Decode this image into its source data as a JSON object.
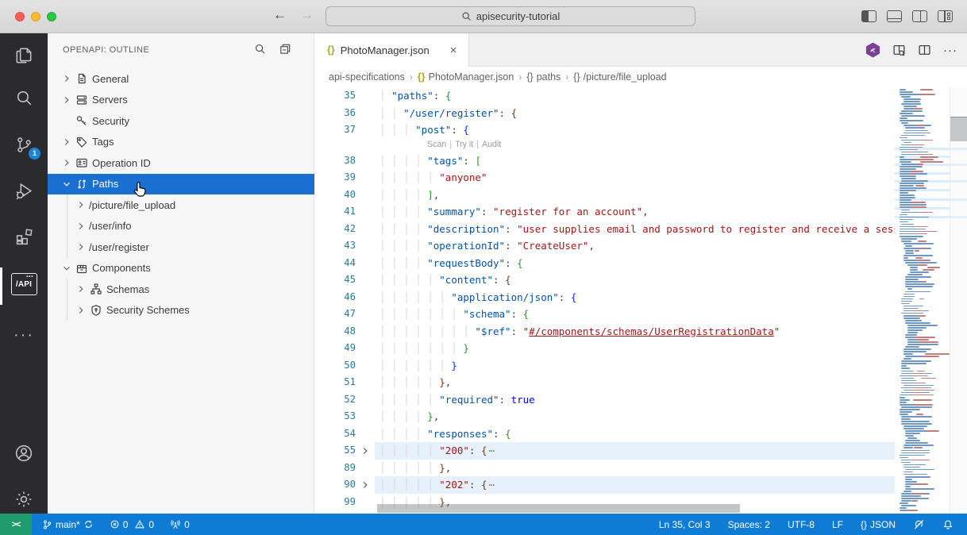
{
  "titlebar": {
    "traffic_lights": [
      "close",
      "minimize",
      "zoom"
    ],
    "back_glyph": "←",
    "forward_glyph": "→",
    "command_center": {
      "value": "apisecurity-tutorial",
      "icon": "search-icon"
    },
    "layout_controls": [
      "toggle-primary-sidebar-icon",
      "toggle-panel-icon",
      "toggle-secondary-sidebar-icon",
      "customize-layout-icon"
    ]
  },
  "activity_bar": {
    "items": [
      {
        "name": "explorer",
        "icon": "files-icon"
      },
      {
        "name": "search",
        "icon": "search-icon"
      },
      {
        "name": "source-control",
        "icon": "source-control-icon",
        "badge": "1"
      },
      {
        "name": "run-debug",
        "icon": "debug-icon"
      },
      {
        "name": "extensions",
        "icon": "extensions-icon"
      },
      {
        "name": "openapi",
        "icon": "api-icon",
        "label": "/API",
        "active": true
      },
      {
        "name": "more",
        "icon": "ellipsis-icon"
      }
    ],
    "bottom": [
      {
        "name": "accounts",
        "icon": "account-icon"
      },
      {
        "name": "settings",
        "icon": "gear-icon"
      }
    ]
  },
  "sidebar": {
    "title": "OPENAPI: OUTLINE",
    "actions": [
      "search-icon",
      "collapse-all-icon"
    ],
    "tree": [
      {
        "label": "General",
        "icon": "file-icon",
        "chevron": "right",
        "depth": 0
      },
      {
        "label": "Servers",
        "icon": "server-icon",
        "chevron": "right",
        "depth": 0
      },
      {
        "label": "Security",
        "icon": "key-icon",
        "chevron": "none",
        "depth": 0
      },
      {
        "label": "Tags",
        "icon": "tag-icon",
        "chevron": "right",
        "depth": 0
      },
      {
        "label": "Operation ID",
        "icon": "id-card-icon",
        "chevron": "right",
        "depth": 0
      },
      {
        "label": "Paths",
        "icon": "paths-icon",
        "chevron": "down",
        "depth": 0,
        "selected": true
      },
      {
        "label": "/picture/file_upload",
        "icon": null,
        "chevron": "right",
        "depth": 1
      },
      {
        "label": "/user/info",
        "icon": null,
        "chevron": "right",
        "depth": 1
      },
      {
        "label": "/user/register",
        "icon": null,
        "chevron": "right",
        "depth": 1
      },
      {
        "label": "Components",
        "icon": "package-icon",
        "chevron": "down",
        "depth": 0
      },
      {
        "label": "Schemas",
        "icon": "schema-icon",
        "chevron": "right",
        "depth": 1
      },
      {
        "label": "Security Schemes",
        "icon": "shield-icon",
        "chevron": "right",
        "depth": 1
      }
    ]
  },
  "editor": {
    "tab": {
      "label": "PhotoManager.json",
      "icon": "json-braces-icon",
      "close": "×"
    },
    "actions": [
      "42crunch-icon",
      "open-preview-icon",
      "split-editor-icon",
      "ellipsis-icon"
    ],
    "breadcrumbs": [
      {
        "label": "api-specifications",
        "icon": null
      },
      {
        "label": "PhotoManager.json",
        "icon": "braces-yellow"
      },
      {
        "label": "paths",
        "icon": "braces-gray"
      },
      {
        "label": "/picture/file_upload",
        "icon": "braces-gray"
      }
    ],
    "codelens_labels": [
      "Scan",
      "Try it",
      "Audit"
    ],
    "fold_marker": "⋯",
    "lines": [
      {
        "n": "35",
        "i": 2,
        "t": [
          [
            "k",
            "\"paths\""
          ],
          [
            "p",
            ": "
          ],
          [
            "b2",
            "{"
          ]
        ]
      },
      {
        "n": "36",
        "i": 4,
        "t": [
          [
            "k",
            "\"/user/register\""
          ],
          [
            "p",
            ": "
          ],
          [
            "b3",
            "{"
          ]
        ]
      },
      {
        "n": "37",
        "i": 6,
        "t": [
          [
            "k",
            "\"post\""
          ],
          [
            "p",
            ": "
          ],
          [
            "b1",
            "{"
          ]
        ]
      },
      {
        "lens": true,
        "i": 8
      },
      {
        "n": "38",
        "i": 8,
        "t": [
          [
            "k",
            "\"tags\""
          ],
          [
            "p",
            ": "
          ],
          [
            "b2",
            "["
          ]
        ]
      },
      {
        "n": "39",
        "i": 10,
        "t": [
          [
            "s",
            "\"anyone\""
          ]
        ]
      },
      {
        "n": "40",
        "i": 8,
        "t": [
          [
            "b2",
            "]"
          ],
          [
            "p",
            ","
          ]
        ]
      },
      {
        "n": "41",
        "i": 8,
        "t": [
          [
            "k",
            "\"summary\""
          ],
          [
            "p",
            ": "
          ],
          [
            "s",
            "\"register for an account\""
          ],
          [
            "p",
            ","
          ]
        ]
      },
      {
        "n": "42",
        "i": 8,
        "t": [
          [
            "k",
            "\"description\""
          ],
          [
            "p",
            ": "
          ],
          [
            "s",
            "\"user supplies email and password to register and receive a session token\""
          ],
          [
            "p",
            ","
          ]
        ]
      },
      {
        "n": "43",
        "i": 8,
        "t": [
          [
            "k",
            "\"operationId\""
          ],
          [
            "p",
            ": "
          ],
          [
            "s",
            "\"CreateUser\""
          ],
          [
            "p",
            ","
          ]
        ]
      },
      {
        "n": "44",
        "i": 8,
        "t": [
          [
            "k",
            "\"requestBody\""
          ],
          [
            "p",
            ": "
          ],
          [
            "b2",
            "{"
          ]
        ]
      },
      {
        "n": "45",
        "i": 10,
        "t": [
          [
            "k",
            "\"content\""
          ],
          [
            "p",
            ": "
          ],
          [
            "b3",
            "{"
          ]
        ]
      },
      {
        "n": "46",
        "i": 12,
        "t": [
          [
            "k",
            "\"application/json\""
          ],
          [
            "p",
            ": "
          ],
          [
            "b1",
            "{"
          ]
        ]
      },
      {
        "n": "47",
        "i": 14,
        "t": [
          [
            "k",
            "\"schema\""
          ],
          [
            "p",
            ": "
          ],
          [
            "b2",
            "{"
          ]
        ]
      },
      {
        "n": "48",
        "i": 16,
        "t": [
          [
            "k",
            "\"$ref\""
          ],
          [
            "p",
            ": "
          ],
          [
            "s",
            "\""
          ],
          [
            "a",
            "#/components/schemas/UserRegistrationData"
          ],
          [
            "s",
            "\""
          ]
        ]
      },
      {
        "n": "49",
        "i": 14,
        "t": [
          [
            "b2",
            "}"
          ]
        ]
      },
      {
        "n": "50",
        "i": 12,
        "t": [
          [
            "b1",
            "}"
          ]
        ]
      },
      {
        "n": "51",
        "i": 10,
        "t": [
          [
            "b3",
            "}"
          ],
          [
            "p",
            ","
          ]
        ]
      },
      {
        "n": "52",
        "i": 10,
        "t": [
          [
            "k",
            "\"required\""
          ],
          [
            "p",
            ": "
          ],
          [
            "bool",
            "true"
          ]
        ]
      },
      {
        "n": "53",
        "i": 8,
        "t": [
          [
            "b2",
            "}"
          ],
          [
            "p",
            ","
          ]
        ]
      },
      {
        "n": "54",
        "i": 8,
        "t": [
          [
            "k",
            "\"responses\""
          ],
          [
            "p",
            ": "
          ],
          [
            "b2",
            "{"
          ]
        ]
      },
      {
        "n": "55",
        "i": 10,
        "hl": true,
        "chev": true,
        "t": [
          [
            "s",
            "\"200\""
          ],
          [
            "p",
            ": "
          ],
          [
            "b3",
            "{"
          ],
          [
            "fold",
            "⋯"
          ]
        ]
      },
      {
        "n": "89",
        "i": 10,
        "t": [
          [
            "b3",
            "}"
          ],
          [
            "p",
            ","
          ]
        ]
      },
      {
        "n": "90",
        "i": 10,
        "hl": true,
        "chev": true,
        "t": [
          [
            "s",
            "\"202\""
          ],
          [
            "p",
            ": "
          ],
          [
            "b3",
            "{"
          ],
          [
            "fold",
            "⋯"
          ]
        ]
      },
      {
        "n": "99",
        "i": 10,
        "t": [
          [
            "b3",
            "}"
          ],
          [
            "p",
            ","
          ]
        ]
      }
    ],
    "minimap_highlight_bands": [
      76,
      86,
      96,
      107,
      117,
      128,
      140,
      151,
      162
    ],
    "scroll_strip_bands": [
      76,
      96,
      117,
      140,
      162
    ]
  },
  "status_bar": {
    "remote_glyph": "><",
    "branch": "main*",
    "errors": "0",
    "warnings": "0",
    "ports": "0",
    "ln_col": "Ln 35, Col 3",
    "spaces": "Spaces: 2",
    "encoding": "UTF-8",
    "eol": "LF",
    "lang_braces": "{}",
    "language": "JSON"
  },
  "colors": {
    "status_bar": "#0e7cd4",
    "remote_indicator": "#1f9b6e",
    "selection_blue": "#1b6fd0",
    "scm_badge": "#1a85d8",
    "crunch_purple": "#7b3f98",
    "json_key": "#0451a5",
    "json_string": "#a31515",
    "bracket_blue": "#0431fa",
    "bracket_green": "#319331",
    "bracket_brown": "#7b3814"
  }
}
